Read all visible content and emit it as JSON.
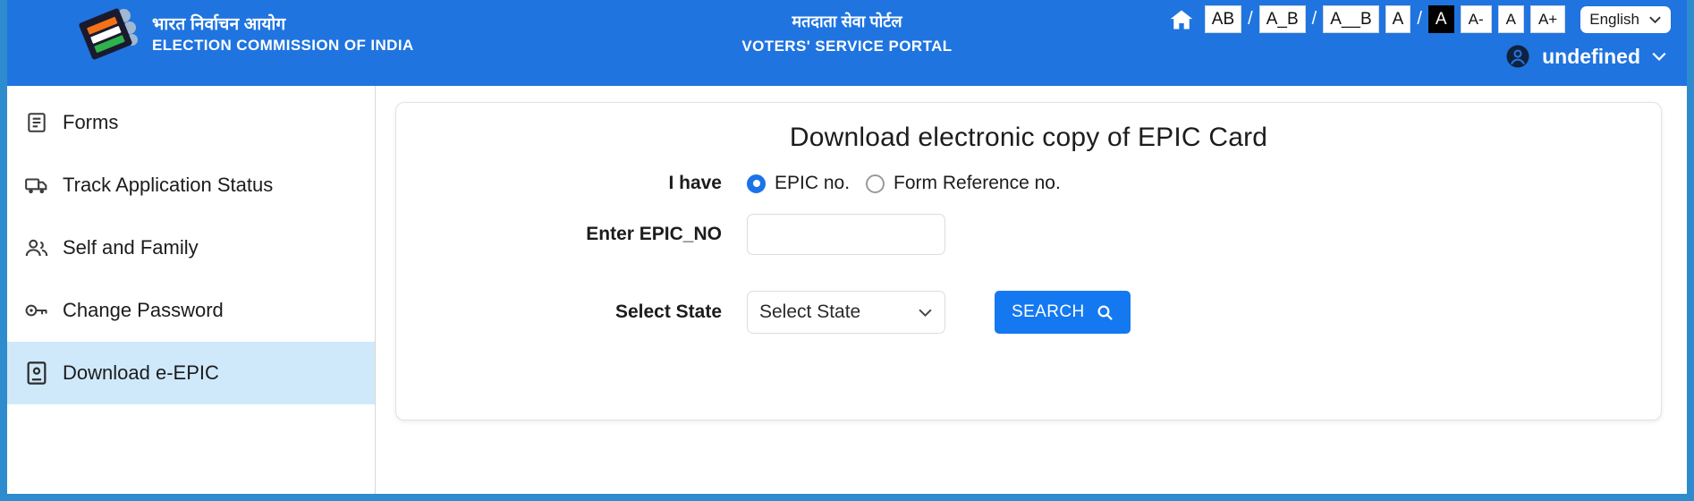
{
  "header": {
    "org_name_hi": "भारत निर्वाचन आयोग",
    "org_name_en": "ELECTION COMMISSION OF INDIA",
    "portal_name_hi": "मतदाता सेवा पोर्टल",
    "portal_name_en": "VOTERS' SERVICE PORTAL",
    "accent_color": "#1f74e0",
    "frame_color": "#2e8bce",
    "a11y": {
      "home_icon": "home-icon",
      "spacing_normal": "AB",
      "spacing_medium": "A_B",
      "spacing_wide": "A__B",
      "separator": "/",
      "contrast_light": "A",
      "contrast_dark": "A",
      "font_decrease": "A-",
      "font_normal": "A",
      "font_increase": "A+"
    },
    "language": {
      "selected": "English",
      "chevron_icon": "chevron-down-icon"
    },
    "account": {
      "icon": "account-circle-icon",
      "name": "undefined",
      "chevron_icon": "chevron-down-icon"
    }
  },
  "sidebar": {
    "items": [
      {
        "label": "Forms",
        "icon": "forms-icon",
        "active": false
      },
      {
        "label": "Track Application Status",
        "icon": "truck-icon",
        "active": false
      },
      {
        "label": "Self and Family",
        "icon": "people-icon",
        "active": false
      },
      {
        "label": "Change Password",
        "icon": "key-icon",
        "active": false
      },
      {
        "label": "Download e-EPIC",
        "icon": "id-card-icon",
        "active": true
      }
    ],
    "active_bg": "#cfe9fb"
  },
  "main": {
    "card_title": "Download electronic copy of EPIC Card",
    "rows": {
      "i_have": {
        "label": "I have",
        "options": [
          {
            "label": "EPIC no.",
            "selected": true
          },
          {
            "label": "Form Reference no.",
            "selected": false
          }
        ]
      },
      "epic_no": {
        "label": "Enter EPIC_NO",
        "value": "",
        "placeholder": ""
      },
      "state": {
        "label": "Select State",
        "selected": "Select State",
        "chevron_icon": "chevron-down-icon"
      }
    },
    "search_button": {
      "label": "SEARCH",
      "icon": "search-icon",
      "color": "#1478f0"
    }
  }
}
